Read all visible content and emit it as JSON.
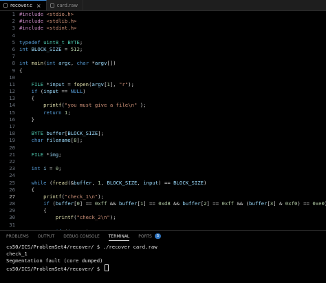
{
  "tabs": [
    {
      "label": "recover.c",
      "active": true
    },
    {
      "label": "card.raw",
      "active": false
    }
  ],
  "editor": {
    "current_line": 27,
    "lines": [
      {
        "n": "1",
        "t": [
          [
            "inc",
            "#include "
          ],
          [
            "str",
            "<stdio.h>"
          ]
        ]
      },
      {
        "n": "2",
        "t": [
          [
            "inc",
            "#include "
          ],
          [
            "str",
            "<stdlib.h>"
          ]
        ]
      },
      {
        "n": "3",
        "t": [
          [
            "inc",
            "#include "
          ],
          [
            "str",
            "<stdint.h>"
          ]
        ]
      },
      {
        "n": "4",
        "t": []
      },
      {
        "n": "5",
        "t": [
          [
            "kw",
            "typedef "
          ],
          [
            "ty",
            "uint8_t "
          ],
          [
            "ty",
            "BYTE"
          ],
          [
            "",
            "; "
          ]
        ]
      },
      {
        "n": "6",
        "t": [
          [
            "kw",
            "int "
          ],
          [
            "var",
            "BLOCK_SIZE"
          ],
          [
            "",
            " = "
          ],
          [
            "num",
            "512"
          ],
          [
            "",
            ";"
          ]
        ]
      },
      {
        "n": "7",
        "t": []
      },
      {
        "n": "8",
        "t": [
          [
            "kw",
            "int "
          ],
          [
            "fn",
            "main"
          ],
          [
            "",
            "("
          ],
          [
            "kw",
            "int "
          ],
          [
            "var",
            "argc"
          ],
          [
            "",
            ", "
          ],
          [
            "kw",
            "char "
          ],
          [
            "",
            "*"
          ],
          [
            "var",
            "argv"
          ],
          [
            "",
            "[])"
          ]
        ]
      },
      {
        "n": "9",
        "t": [
          [
            "",
            "{"
          ]
        ]
      },
      {
        "n": "10",
        "t": []
      },
      {
        "n": "11",
        "t": [
          [
            "",
            "    "
          ],
          [
            "ty",
            "FILE "
          ],
          [
            "",
            "*"
          ],
          [
            "var",
            "input"
          ],
          [
            "",
            " = "
          ],
          [
            "fn",
            "fopen"
          ],
          [
            "",
            "("
          ],
          [
            "var",
            "argv"
          ],
          [
            "",
            "["
          ],
          [
            "num",
            "1"
          ],
          [
            "",
            "], "
          ],
          [
            "str",
            "\"r\""
          ],
          [
            "",
            ");"
          ]
        ]
      },
      {
        "n": "12",
        "t": [
          [
            "",
            "    "
          ],
          [
            "kw",
            "if "
          ],
          [
            "",
            "("
          ],
          [
            "var",
            "input"
          ],
          [
            "",
            " == "
          ],
          [
            "kw",
            "NULL"
          ],
          [
            "",
            ")"
          ]
        ]
      },
      {
        "n": "13",
        "t": [
          [
            "",
            "    {"
          ]
        ]
      },
      {
        "n": "14",
        "t": [
          [
            "",
            "        "
          ],
          [
            "fn",
            "printf"
          ],
          [
            "",
            "("
          ],
          [
            "str",
            "\"you must give a file\\n\""
          ],
          [
            "",
            " );"
          ]
        ]
      },
      {
        "n": "15",
        "t": [
          [
            "",
            "        "
          ],
          [
            "kw",
            "return "
          ],
          [
            "num",
            "1"
          ],
          [
            "",
            ";"
          ]
        ]
      },
      {
        "n": "16",
        "t": [
          [
            "",
            "    }"
          ]
        ]
      },
      {
        "n": "17",
        "t": []
      },
      {
        "n": "18",
        "t": [
          [
            "",
            "    "
          ],
          [
            "ty",
            "BYTE "
          ],
          [
            "var",
            "buffer"
          ],
          [
            "",
            "["
          ],
          [
            "var",
            "BLOCK_SIZE"
          ],
          [
            "",
            "];"
          ]
        ]
      },
      {
        "n": "19",
        "t": [
          [
            "",
            "    "
          ],
          [
            "kw",
            "char "
          ],
          [
            "var",
            "filename"
          ],
          [
            "",
            "["
          ],
          [
            "num",
            "8"
          ],
          [
            "",
            "];"
          ]
        ]
      },
      {
        "n": "20",
        "t": []
      },
      {
        "n": "21",
        "t": [
          [
            "",
            "    "
          ],
          [
            "ty",
            "FILE "
          ],
          [
            "",
            "*"
          ],
          [
            "var",
            "img"
          ],
          [
            "",
            ";"
          ]
        ]
      },
      {
        "n": "22",
        "t": []
      },
      {
        "n": "23",
        "t": [
          [
            "",
            "    "
          ],
          [
            "kw",
            "int "
          ],
          [
            "var",
            "i"
          ],
          [
            "",
            " = "
          ],
          [
            "num",
            "0"
          ],
          [
            "",
            ";"
          ]
        ]
      },
      {
        "n": "24",
        "t": []
      },
      {
        "n": "25",
        "t": [
          [
            "",
            "    "
          ],
          [
            "kw",
            "while "
          ],
          [
            "",
            "("
          ],
          [
            "fn",
            "fread"
          ],
          [
            "",
            "(&"
          ],
          [
            "var",
            "buffer"
          ],
          [
            "",
            ", "
          ],
          [
            "num",
            "1"
          ],
          [
            "",
            ", "
          ],
          [
            "var",
            "BLOCK_SIZE"
          ],
          [
            "",
            ", "
          ],
          [
            "var",
            "input"
          ],
          [
            "",
            ") == "
          ],
          [
            "var",
            "BLOCK_SIZE"
          ],
          [
            "",
            ")"
          ]
        ]
      },
      {
        "n": "26",
        "t": [
          [
            "",
            "    {"
          ]
        ]
      },
      {
        "n": "27",
        "t": [
          [
            "",
            "        "
          ],
          [
            "fn",
            "printf"
          ],
          [
            "",
            "("
          ],
          [
            "str",
            "\"check_1\\n\""
          ],
          [
            "",
            ");"
          ]
        ]
      },
      {
        "n": "28",
        "t": [
          [
            "",
            "        "
          ],
          [
            "kw",
            "if "
          ],
          [
            "",
            "("
          ],
          [
            "var",
            "buffer"
          ],
          [
            "",
            "["
          ],
          [
            "num",
            "0"
          ],
          [
            "",
            "] == "
          ],
          [
            "num",
            "0xff"
          ],
          [
            "",
            " && "
          ],
          [
            "var",
            "buffer"
          ],
          [
            "",
            "["
          ],
          [
            "num",
            "1"
          ],
          [
            "",
            "] == "
          ],
          [
            "num",
            "0xd8"
          ],
          [
            "",
            " && "
          ],
          [
            "var",
            "buffer"
          ],
          [
            "",
            "["
          ],
          [
            "num",
            "2"
          ],
          [
            "",
            "] == "
          ],
          [
            "num",
            "0xff"
          ],
          [
            "",
            " && ("
          ],
          [
            "var",
            "buffer"
          ],
          [
            "",
            "["
          ],
          [
            "num",
            "3"
          ],
          [
            "",
            "] & "
          ],
          [
            "num",
            "0xf0"
          ],
          [
            "",
            ") == "
          ],
          [
            "num",
            "0xe0"
          ],
          [
            "",
            ")"
          ]
        ]
      },
      {
        "n": "29",
        "t": [
          [
            "",
            "        {"
          ]
        ]
      },
      {
        "n": "30",
        "t": [
          [
            "",
            "            "
          ],
          [
            "fn",
            "printf"
          ],
          [
            "",
            "("
          ],
          [
            "str",
            "\"check_2\\n\""
          ],
          [
            "",
            ");"
          ]
        ]
      },
      {
        "n": "31",
        "t": []
      },
      {
        "n": "32",
        "t": [
          [
            "",
            "            "
          ],
          [
            "kw",
            "if "
          ],
          [
            "",
            "("
          ],
          [
            "var",
            "i"
          ],
          [
            "",
            " == "
          ],
          [
            "num",
            "0"
          ],
          [
            "",
            ")"
          ]
        ]
      }
    ]
  },
  "panel": {
    "tabs": [
      {
        "label": "PROBLEMS",
        "active": false
      },
      {
        "label": "OUTPUT",
        "active": false
      },
      {
        "label": "DEBUG CONSOLE",
        "active": false
      },
      {
        "label": "TERMINAL",
        "active": true
      },
      {
        "label": "PORTS",
        "active": false,
        "badge": "5"
      }
    ],
    "terminal": [
      "cs50/ICS/ProblemSet4/recover/ $ ./recover card.raw",
      "check_1",
      "Segmentation fault (core dumped)",
      "cs50/ICS/ProblemSet4/recover/ $ "
    ]
  },
  "colors": {
    "background": "#000000",
    "keyword": "#569cd6",
    "type": "#4ec9b0",
    "string": "#ce9178",
    "number": "#b5cea8",
    "function": "#dcdcaa",
    "variable": "#9cdcfe",
    "accent": "#2f74c0"
  }
}
